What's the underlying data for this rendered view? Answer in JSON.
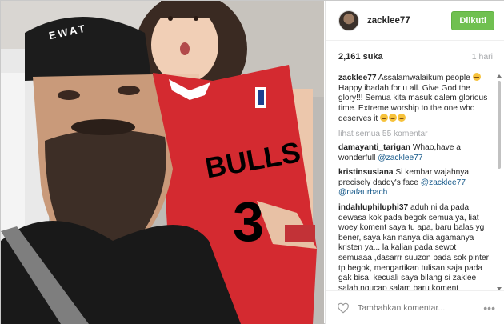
{
  "post": {
    "username": "zacklee77",
    "follow_label": "Diikuti",
    "likes": "2,161 suka",
    "time": "1 hari",
    "photo_texts": {
      "cap_letters": "EWAT",
      "jersey_wordmark": "BULLS",
      "jersey_number": "3"
    },
    "caption": {
      "user": "zacklee77",
      "text": "Assalamwalaikum people",
      "text2": "Happy ibadah for u all. Give God the glory!!! Semua kita masuk dalem glorious time. Extreme worship to the one who deserves it"
    },
    "view_all": "lihat semua 55 komentar",
    "comments": [
      {
        "user": "damayanti_tarigan",
        "text": "Whao,have a wonderfull",
        "mention": "@zacklee77"
      },
      {
        "user": "kristinsusiana",
        "text": "Si kembar wajahnya precisely daddy's face",
        "mention": "@zacklee77",
        "mention2": "@nafaurbach"
      },
      {
        "user": "indahluphiluphi37",
        "text": "aduh ni da pada dewasa kok pada begok semua ya, liat woey koment saya tu apa, baru balas yg bener, saya kan nanya dia agamanya kristen ya... la kalian pada sewot semuaaa ,dasarrr suuzon pada sok pinter tp begok, mengartikan tulisan saja pada gak bisa, kecuali saya bilang si zaklee salah ngucap salam baru koment"
      }
    ],
    "add_comment_placeholder": "Tambahkan komentar...",
    "more_icon": "more-options-icon",
    "like_icon": "heart-icon"
  }
}
